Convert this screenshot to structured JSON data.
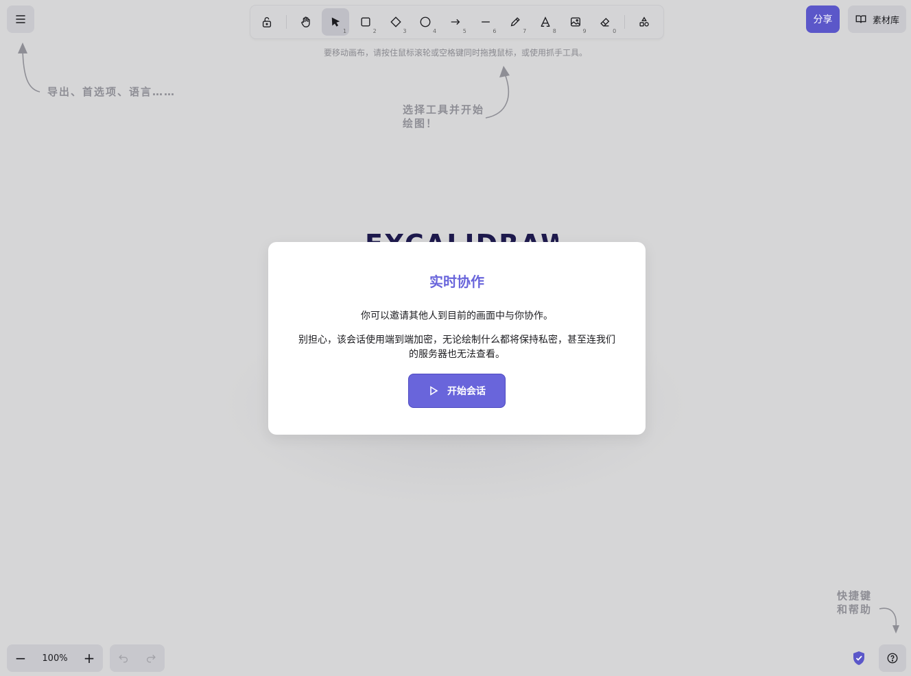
{
  "toolbar": {
    "tools": [
      {
        "name": "lock",
        "key": ""
      },
      {
        "name": "hand",
        "key": ""
      },
      {
        "name": "selection",
        "key": "1"
      },
      {
        "name": "rectangle",
        "key": "2"
      },
      {
        "name": "diamond",
        "key": "3"
      },
      {
        "name": "ellipse",
        "key": "4"
      },
      {
        "name": "arrow",
        "key": "5"
      },
      {
        "name": "line",
        "key": "6"
      },
      {
        "name": "draw",
        "key": "7"
      },
      {
        "name": "text",
        "key": "8"
      },
      {
        "name": "image",
        "key": "9"
      },
      {
        "name": "eraser",
        "key": "0"
      },
      {
        "name": "more-shapes",
        "key": ""
      }
    ],
    "active": "selection",
    "hint": "要移动画布，请按住鼠标滚轮或空格键同时拖拽鼠标，或使用抓手工具。"
  },
  "header": {
    "share_label": "分享",
    "library_label": "素材库"
  },
  "hints": {
    "menu": "导出、首选项、语言……",
    "tools_line1": "选择工具并开始",
    "tools_line2": "绘图！",
    "help_line1": "快捷键",
    "help_line2": "和帮助"
  },
  "welcome": {
    "logo_text": "EXCALIDRAW"
  },
  "modal": {
    "title": "实时协作",
    "p1": "你可以邀请其他人到目前的画面中与你协作。",
    "p2": "别担心，该会话使用端到端加密，无论绘制什么都将保持私密，甚至连我们的服务器也无法查看。",
    "start_label": "开始会话"
  },
  "footer": {
    "zoom_value": "100%",
    "zoom_out": "−",
    "zoom_in": "+"
  },
  "colors": {
    "accent": "#6965db",
    "share": "#5b57c9",
    "background": "#d6d6d7"
  }
}
